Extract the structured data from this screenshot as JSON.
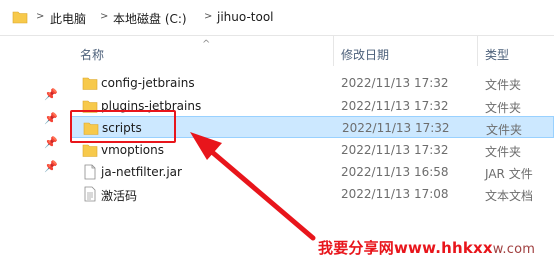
{
  "address_bar": {
    "separator": ">",
    "crumbs": [
      "此电脑",
      "本地磁盘 (C:)",
      "jihuo-tool"
    ]
  },
  "columns": {
    "name": "名称",
    "sort_indicator": "^",
    "date": "修改日期",
    "type": "类型"
  },
  "rows": [
    {
      "name": "config-jetbrains",
      "date": "2022/11/13 17:32",
      "type": "文件夹",
      "icon": "folder-icon"
    },
    {
      "name": "plugins-jetbrains",
      "date": "2022/11/13 17:32",
      "type": "文件夹",
      "icon": "folder-icon"
    },
    {
      "name": "scripts",
      "date": "2022/11/13 17:32",
      "type": "文件夹",
      "icon": "folder-icon",
      "selected": true
    },
    {
      "name": "vmoptions",
      "date": "2022/11/13 17:32",
      "type": "文件夹",
      "icon": "folder-icon"
    },
    {
      "name": "ja-netfilter.jar",
      "date": "2022/11/13 16:58",
      "type": "JAR 文件",
      "icon": "jar-file-icon"
    },
    {
      "name": "激活码",
      "date": "2022/11/13 17:08",
      "type": "文本文档",
      "icon": "text-file-icon"
    }
  ],
  "watermark": {
    "text": "我要分享网www.hhkxx",
    "tail": "w.com"
  },
  "colors": {
    "folder": "#f7c94b",
    "selection": "#cce8ff",
    "annotation": "#e8151b"
  }
}
